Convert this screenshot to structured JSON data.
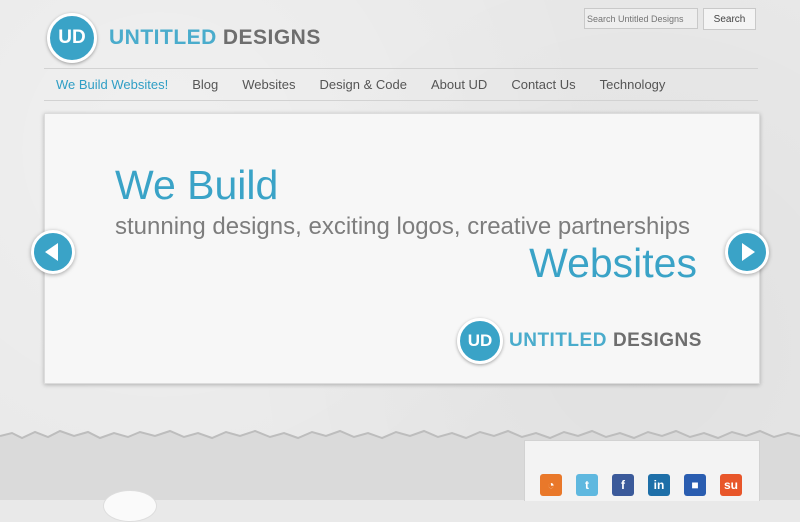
{
  "brand": {
    "badge": "UD",
    "name_part1": "UNTITLED",
    "name_part2": "DESIGNS"
  },
  "search": {
    "placeholder": "Search Untitled Designs",
    "button_label": "Search"
  },
  "nav": {
    "items": [
      {
        "label": "We Build Websites!"
      },
      {
        "label": "Blog"
      },
      {
        "label": "Websites"
      },
      {
        "label": "Design & Code"
      },
      {
        "label": "About UD"
      },
      {
        "label": "Contact Us"
      },
      {
        "label": "Technology"
      }
    ]
  },
  "slide": {
    "headline": "We Build",
    "subline": "stunning designs, exciting logos, creative partnerships",
    "headline2": "Websites"
  },
  "social": {
    "icons": [
      {
        "name": "rss-icon",
        "color": "#e9782a",
        "glyph": "◔"
      },
      {
        "name": "twitter-icon",
        "color": "#5fb8df",
        "glyph": "t"
      },
      {
        "name": "facebook-icon",
        "color": "#3b5a9a",
        "glyph": "f"
      },
      {
        "name": "linkedin-icon",
        "color": "#1e6fa8",
        "glyph": "in"
      },
      {
        "name": "delicious-icon",
        "color": "#2a5db0",
        "glyph": "■"
      },
      {
        "name": "stumbleupon-icon",
        "color": "#e8562a",
        "glyph": "su"
      }
    ]
  },
  "colors": {
    "accent": "#3aa3c7",
    "text_gray": "#6e6e6e",
    "background": "#e9e9e9"
  }
}
